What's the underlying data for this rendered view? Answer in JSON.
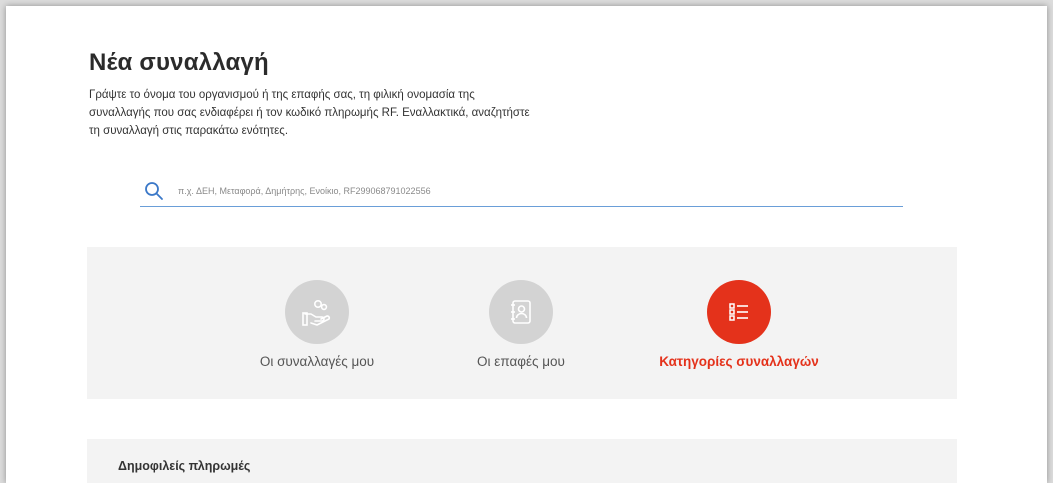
{
  "page": {
    "title": "Νέα συναλλαγή",
    "intro_lines": [
      "Γράψτε το όνομα του οργανισμού ή της επαφής σας, τη φιλική ονομασία της",
      "συναλλαγής που σας ενδιαφέρει ή τον κωδικό πληρωμής RF. Εναλλακτικά, αναζητήστε",
      "τη συναλλαγή στις παρακάτω ενότητες."
    ]
  },
  "search": {
    "placeholder": "π.χ. ΔΕΗ, Μεταφορά, Δημήτρης, Ενοίκιο, RF299068791022556",
    "value": "",
    "icon": "search-icon"
  },
  "tiles": [
    {
      "label": "Οι συναλλαγές μου",
      "icon": "hand-coins-icon",
      "active": false
    },
    {
      "label": "Οι επαφές μου",
      "icon": "contacts-book-icon",
      "active": false
    },
    {
      "label": "Κατηγορίες συναλλαγών",
      "icon": "category-list-icon",
      "active": true
    }
  ],
  "popular": {
    "title": "Δημοφιλείς πληρωμές"
  },
  "colors": {
    "accent": "#e4321b",
    "inactive_circle": "#d3d3d3",
    "panel_bg": "#f3f3f3",
    "search_underline": "#6a9ed8"
  }
}
